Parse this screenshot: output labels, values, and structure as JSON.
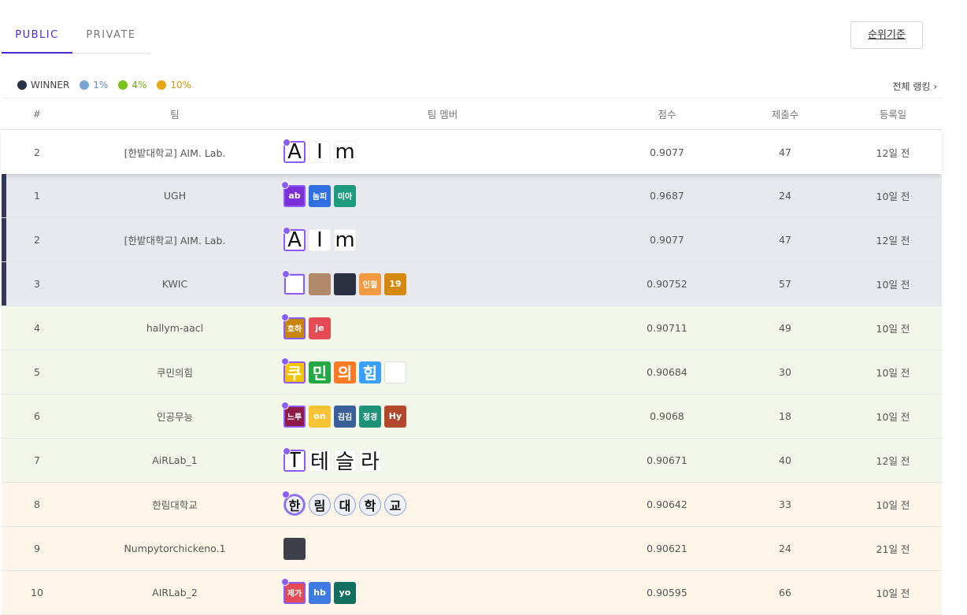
{
  "tabs": {
    "public": "PUBLIC",
    "private": "PRIVATE"
  },
  "criteria_button": "순위기준",
  "legend": [
    {
      "label": "WINNER",
      "color": "#273349",
      "text_color": "#444444"
    },
    {
      "label": "1%",
      "color": "#78a6d3",
      "text_color": "#5b8fc4"
    },
    {
      "label": "4%",
      "color": "#7cc218",
      "text_color": "#6aaa12"
    },
    {
      "label": "10%",
      "color": "#e9a515",
      "text_color": "#d99411"
    }
  ],
  "full_ranking": "전체 랭킹 ›",
  "columns": {
    "rank": "#",
    "team": "팀",
    "members": "팀 멤버",
    "score": "점수",
    "submissions": "제출수",
    "date": "등록일"
  },
  "colors": {
    "winner_bar": "#2e3a57",
    "leader_border": "#8b5cf6",
    "active_tab": "#4b2ad6"
  },
  "rows": [
    {
      "rank": "2",
      "team": "[한밭대학교] AIM. Lab.",
      "score": "0.9077",
      "submissions": "47",
      "date": "12일 전",
      "tier": "mine",
      "members": [
        {
          "text": "A",
          "style": "big",
          "leader": true
        },
        {
          "text": "I",
          "style": "big"
        },
        {
          "text": "m",
          "style": "big"
        }
      ]
    },
    {
      "rank": "1",
      "team": "UGH",
      "score": "0.9687",
      "submissions": "24",
      "date": "10일 전",
      "tier": "winner",
      "members": [
        {
          "text": "ab",
          "bg": "#7b2fd6",
          "leader": true
        },
        {
          "text": "놈피",
          "bg": "#2f6fe0",
          "small": true
        },
        {
          "text": "미아",
          "bg": "#1e9a7e",
          "small": true
        }
      ]
    },
    {
      "rank": "2",
      "team": "[한밭대학교] AIM. Lab.",
      "score": "0.9077",
      "submissions": "47",
      "date": "12일 전",
      "tier": "winner",
      "members": [
        {
          "text": "A",
          "style": "big",
          "leader": true
        },
        {
          "text": "I",
          "style": "big"
        },
        {
          "text": "m",
          "style": "big"
        }
      ]
    },
    {
      "rank": "3",
      "team": "KWIC",
      "score": "0.90752",
      "submissions": "57",
      "date": "10일 전",
      "tier": "winner",
      "members": [
        {
          "text": "",
          "bg": "#ffffff",
          "leader": true,
          "img": "light-icon"
        },
        {
          "text": "",
          "bg": "#b08a6a",
          "img": "photo-icon"
        },
        {
          "text": "",
          "bg": "#2a3040",
          "img": "night-city-icon"
        },
        {
          "text": "인절",
          "bg": "#f19a42",
          "small": true
        },
        {
          "text": "19",
          "bg": "#d48a0e"
        }
      ]
    },
    {
      "rank": "4",
      "team": "hallym-aacl",
      "score": "0.90711",
      "submissions": "49",
      "date": "10일 전",
      "tier": "tier1",
      "members": [
        {
          "text": "호하",
          "bg": "#c8860c",
          "leader": true,
          "small": true
        },
        {
          "text": "je",
          "bg": "#e44b55"
        }
      ]
    },
    {
      "rank": "5",
      "team": "쿠민의힘",
      "score": "0.90684",
      "submissions": "30",
      "date": "10일 전",
      "tier": "tier1",
      "members": [
        {
          "text": "쿠",
          "style": "ko",
          "bg": "#f5c400",
          "leader": true
        },
        {
          "text": "민",
          "style": "ko",
          "bg": "#22a845"
        },
        {
          "text": "의",
          "style": "ko",
          "bg": "#ff7a22"
        },
        {
          "text": "힘",
          "style": "ko",
          "bg": "#3aa0ff"
        },
        {
          "text": "",
          "bg": "#ffffff",
          "img": "logo-icon"
        }
      ]
    },
    {
      "rank": "6",
      "team": "인공무능",
      "score": "0.9068",
      "submissions": "18",
      "date": "10일 전",
      "tier": "tier1",
      "members": [
        {
          "text": "느루",
          "bg": "#8d1b45",
          "leader": true,
          "small": true
        },
        {
          "text": "on",
          "bg": "#f7c533"
        },
        {
          "text": "김김",
          "bg": "#3a5f9a",
          "small": true
        },
        {
          "text": "정경",
          "bg": "#1f9377",
          "small": true
        },
        {
          "text": "Hy",
          "bg": "#b3492c"
        }
      ]
    },
    {
      "rank": "7",
      "team": "AiRLab_1",
      "score": "0.90671",
      "submissions": "40",
      "date": "12일 전",
      "tier": "tier1",
      "members": [
        {
          "text": "T",
          "style": "big",
          "leader": true
        },
        {
          "text": "테",
          "style": "big"
        },
        {
          "text": "슬",
          "style": "big"
        },
        {
          "text": "라",
          "style": "big"
        }
      ]
    },
    {
      "rank": "8",
      "team": "한림대학교",
      "score": "0.90642",
      "submissions": "33",
      "date": "10일 전",
      "tier": "tier2",
      "members": [
        {
          "text": "한",
          "style": "circle",
          "leader": true
        },
        {
          "text": "림",
          "style": "circle"
        },
        {
          "text": "대",
          "style": "circle"
        },
        {
          "text": "학",
          "style": "circle"
        },
        {
          "text": "교",
          "style": "circle"
        }
      ]
    },
    {
      "rank": "9",
      "team": "Numpytorchickeno.1",
      "score": "0.90621",
      "submissions": "24",
      "date": "21일 전",
      "tier": "tier2",
      "members": [
        {
          "text": "",
          "bg": "#3d4048",
          "img": "photo-icon"
        }
      ]
    },
    {
      "rank": "10",
      "team": "AIRLab_2",
      "score": "0.90595",
      "submissions": "66",
      "date": "10일 전",
      "tier": "tier2",
      "members": [
        {
          "text": "제가",
          "bg": "#e44b55",
          "leader": true,
          "small": true
        },
        {
          "text": "hb",
          "bg": "#3f7be0"
        },
        {
          "text": "yo",
          "bg": "#126e5f"
        }
      ]
    }
  ]
}
